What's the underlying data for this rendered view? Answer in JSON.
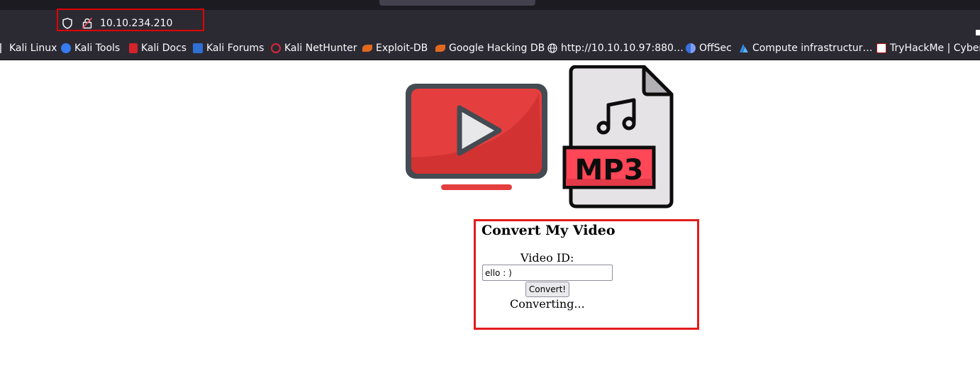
{
  "browser": {
    "url": "10.10.234.210",
    "bookmarks": [
      {
        "label": "Kali Linux",
        "icon": "kali-dragon-icon",
        "color": "#2d8fd5"
      },
      {
        "label": "Kali Tools",
        "icon": "kali-tools-icon",
        "color": "#367bf0"
      },
      {
        "label": "Kali Docs",
        "icon": "kali-docs-icon",
        "color": "#d4232a"
      },
      {
        "label": "Kali Forums",
        "icon": "kali-forums-icon",
        "color": "#2f6fd6"
      },
      {
        "label": "Kali NetHunter",
        "icon": "nethunter-icon",
        "color": "#d8263a"
      },
      {
        "label": "Exploit-DB",
        "icon": "exploit-db-icon",
        "color": "#e0691f"
      },
      {
        "label": "Google Hacking DB",
        "icon": "ghdb-icon",
        "color": "#e0691f"
      },
      {
        "label": "http://10.10.10.97:880…",
        "icon": "globe-icon",
        "color": "#fbfbfe"
      },
      {
        "label": "OffSec",
        "icon": "offsec-icon",
        "color": "#3a6fe0"
      },
      {
        "label": "Compute infrastructur…",
        "icon": "azure-icon",
        "color": "#2f8be6"
      },
      {
        "label": "TryHackMe | Cyber",
        "icon": "tryhackme-icon",
        "color": "#c11111"
      }
    ]
  },
  "page": {
    "logo_text": "MP3",
    "form": {
      "title": "Convert My Video",
      "video_id_label": "Video ID:",
      "video_id_value": "ello : )",
      "submit_label": "Convert!",
      "status": "Converting..."
    }
  },
  "colors": {
    "highlight_box": "#e21c1c",
    "youtube_red": "#e53e3e",
    "mp3_red": "#ff4757"
  }
}
